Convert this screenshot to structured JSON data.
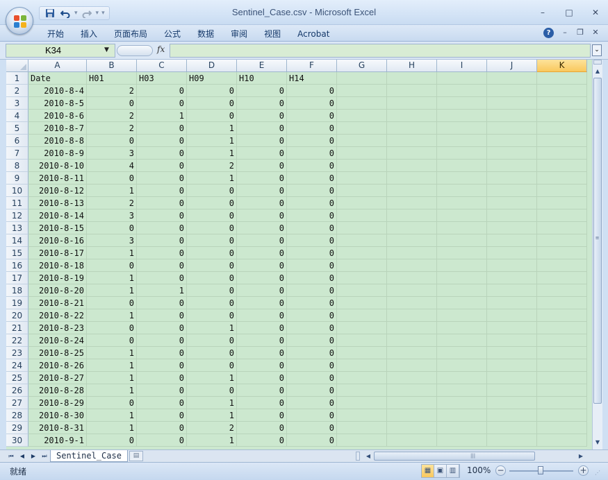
{
  "window": {
    "title": "Sentinel_Case.csv - Microsoft Excel",
    "minimize": "–",
    "maximize": "□",
    "close": "✕"
  },
  "qat": {
    "save_icon": "floppy-disk",
    "undo_icon": "undo-arrow",
    "redo_icon": "redo-arrow",
    "customize_icon": "dropdown-arrow"
  },
  "ribbon": {
    "tabs": [
      "开始",
      "插入",
      "页面布局",
      "公式",
      "数据",
      "审阅",
      "视图",
      "Acrobat"
    ],
    "help": "?"
  },
  "formula_bar": {
    "name_box": "K34",
    "fx": "fx",
    "value": ""
  },
  "grid": {
    "columns": [
      "A",
      "B",
      "C",
      "D",
      "E",
      "F",
      "G",
      "H",
      "I",
      "J",
      "K"
    ],
    "selected_column": "K",
    "row_numbers": [
      "1",
      "2",
      "3",
      "4",
      "5",
      "6",
      "7",
      "8",
      "9",
      "10",
      "11",
      "12",
      "13",
      "14",
      "15",
      "16",
      "17",
      "18",
      "19",
      "20",
      "21",
      "22",
      "23",
      "24",
      "25",
      "26",
      "27",
      "28",
      "29",
      "30"
    ],
    "header_row": [
      "Date",
      "H01",
      "H03",
      "H09",
      "H10",
      "H14"
    ],
    "rows": [
      [
        "2010-8-4",
        "2",
        "0",
        "0",
        "0",
        "0"
      ],
      [
        "2010-8-5",
        "0",
        "0",
        "0",
        "0",
        "0"
      ],
      [
        "2010-8-6",
        "2",
        "1",
        "0",
        "0",
        "0"
      ],
      [
        "2010-8-7",
        "2",
        "0",
        "1",
        "0",
        "0"
      ],
      [
        "2010-8-8",
        "0",
        "0",
        "1",
        "0",
        "0"
      ],
      [
        "2010-8-9",
        "3",
        "0",
        "1",
        "0",
        "0"
      ],
      [
        "2010-8-10",
        "4",
        "0",
        "2",
        "0",
        "0"
      ],
      [
        "2010-8-11",
        "0",
        "0",
        "1",
        "0",
        "0"
      ],
      [
        "2010-8-12",
        "1",
        "0",
        "0",
        "0",
        "0"
      ],
      [
        "2010-8-13",
        "2",
        "0",
        "0",
        "0",
        "0"
      ],
      [
        "2010-8-14",
        "3",
        "0",
        "0",
        "0",
        "0"
      ],
      [
        "2010-8-15",
        "0",
        "0",
        "0",
        "0",
        "0"
      ],
      [
        "2010-8-16",
        "3",
        "0",
        "0",
        "0",
        "0"
      ],
      [
        "2010-8-17",
        "1",
        "0",
        "0",
        "0",
        "0"
      ],
      [
        "2010-8-18",
        "0",
        "0",
        "0",
        "0",
        "0"
      ],
      [
        "2010-8-19",
        "1",
        "0",
        "0",
        "0",
        "0"
      ],
      [
        "2010-8-20",
        "1",
        "1",
        "0",
        "0",
        "0"
      ],
      [
        "2010-8-21",
        "0",
        "0",
        "0",
        "0",
        "0"
      ],
      [
        "2010-8-22",
        "1",
        "0",
        "0",
        "0",
        "0"
      ],
      [
        "2010-8-23",
        "0",
        "0",
        "1",
        "0",
        "0"
      ],
      [
        "2010-8-24",
        "0",
        "0",
        "0",
        "0",
        "0"
      ],
      [
        "2010-8-25",
        "1",
        "0",
        "0",
        "0",
        "0"
      ],
      [
        "2010-8-26",
        "1",
        "0",
        "0",
        "0",
        "0"
      ],
      [
        "2010-8-27",
        "1",
        "0",
        "1",
        "0",
        "0"
      ],
      [
        "2010-8-28",
        "1",
        "0",
        "0",
        "0",
        "0"
      ],
      [
        "2010-8-29",
        "0",
        "0",
        "1",
        "0",
        "0"
      ],
      [
        "2010-8-30",
        "1",
        "0",
        "1",
        "0",
        "0"
      ],
      [
        "2010-8-31",
        "1",
        "0",
        "2",
        "0",
        "0"
      ],
      [
        "2010-9-1",
        "0",
        "0",
        "1",
        "0",
        "0"
      ]
    ]
  },
  "sheets": {
    "active": "Sentinel_Case"
  },
  "status": {
    "ready": "就绪",
    "zoom": "100%",
    "zoom_out": "−",
    "zoom_in": "+"
  },
  "colors": {
    "cell_background": "#cce8cf",
    "selected_header": "#f9c85d",
    "chrome_blue": "#cfe0f3"
  }
}
